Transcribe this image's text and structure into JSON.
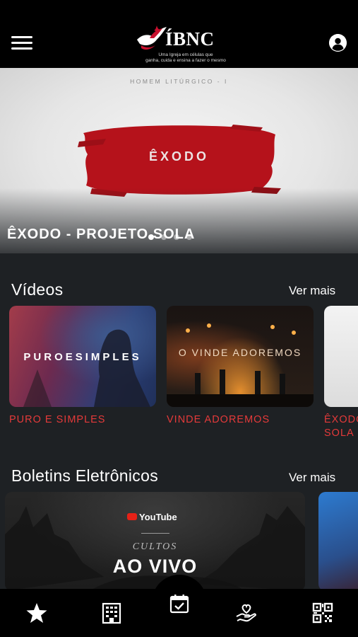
{
  "app": {
    "logo_text": "ÍBNC",
    "tagline_line1": "Uma Igreja em células que",
    "tagline_line2": "ganha, cuida e ensina a fazer o mesmo",
    "icons": {
      "menu": "hamburger-menu-icon",
      "profile": "user-circle-icon",
      "logo": "dove-logo"
    }
  },
  "hero": {
    "overline": "HOMEM LITÚRGICO - I",
    "art_title": "ÊXODO",
    "title": "ÊXODO - PROJETO SOLA",
    "slide_count": 4,
    "active_slide": 1
  },
  "videos": {
    "title": "Vídeos",
    "see_more": "Ver mais",
    "items": [
      {
        "label": "PURO E SIMPLES",
        "thumb_text": "PUROESIMPLES"
      },
      {
        "label": "VINDE ADOREMOS",
        "thumb_text": "O VINDE ADOREMOS"
      },
      {
        "label": "ÊXODO - PROJETO SOLA",
        "label_line1": "ÊXODO -",
        "label_line2": "SOLA"
      }
    ]
  },
  "bulletins": {
    "title": "Boletins Eletrônicos",
    "see_more": "Ver mais",
    "items": [
      {
        "badge": "YouTube",
        "subtitle": "CULTOS",
        "title": "AO VIVO"
      }
    ]
  },
  "bottom_nav": {
    "items": [
      {
        "icon": "star-icon"
      },
      {
        "icon": "building-icon"
      },
      {
        "icon": "calendar-check-icon"
      },
      {
        "icon": "hand-heart-icon"
      },
      {
        "icon": "qr-code-icon"
      }
    ]
  },
  "colors": {
    "background": "#1e2124",
    "header": "#000000",
    "accent_red": "#e53a3a",
    "brush_red": "#b5121b"
  }
}
